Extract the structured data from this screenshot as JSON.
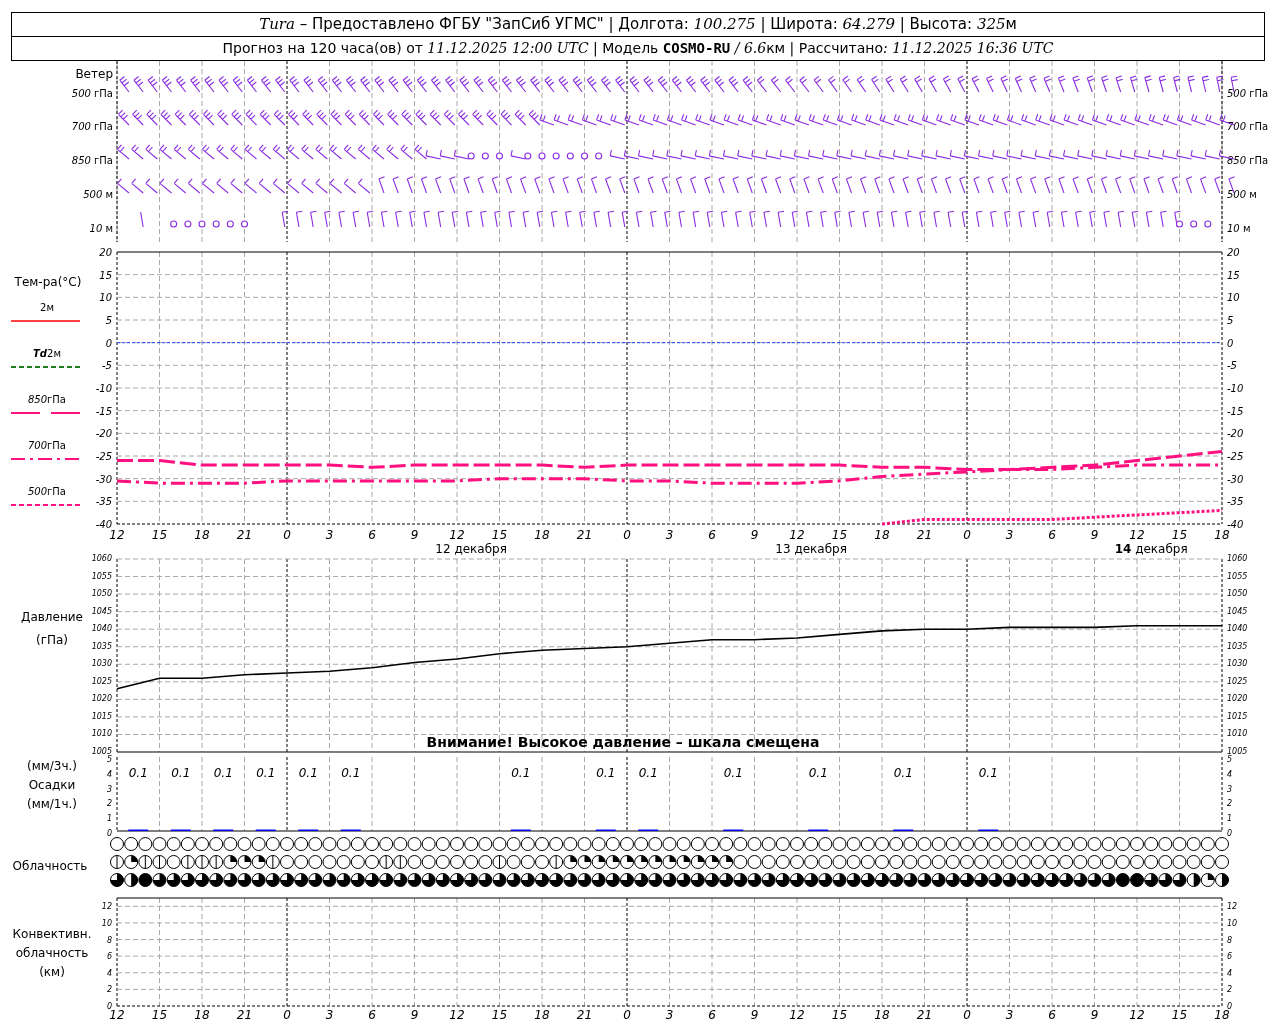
{
  "header": {
    "line1": [
      {
        "text": "Tura",
        "kind": "value"
      },
      {
        "text": " – Предоставлено ФГБУ \"ЗапСиб УГМС\" | Долгота: ",
        "kind": "caption"
      },
      {
        "text": "100.275",
        "kind": "value"
      },
      {
        "text": " | Широта: ",
        "kind": "caption"
      },
      {
        "text": "64.279",
        "kind": "value"
      },
      {
        "text": " | Высота: ",
        "kind": "caption"
      },
      {
        "text": "325",
        "kind": "value"
      },
      {
        "text": "м",
        "kind": "caption"
      }
    ],
    "line2": [
      {
        "text": "Прогноз на 120 часа(ов) от ",
        "kind": "caption"
      },
      {
        "text": "11.12.2025 12:00 UTC",
        "kind": "value"
      },
      {
        "text": "  | Модель ",
        "kind": "caption"
      },
      {
        "text": "COSMO-RU",
        "kind": "model"
      },
      {
        "text": " / 6.6",
        "kind": "value"
      },
      {
        "text": "км | Рассчитано",
        "kind": "caption"
      },
      {
        "text": ": 11.12.2025 16:36 UTC",
        "kind": "value"
      }
    ]
  },
  "wind": {
    "title": "Ветер",
    "levels": [
      {
        "value": "500",
        "unit": "гПа"
      },
      {
        "value": "700",
        "unit": "гПа"
      },
      {
        "value": "850",
        "unit": "гПа"
      },
      {
        "value": "500",
        "unit": "м"
      },
      {
        "value": "10",
        "unit": "м"
      }
    ],
    "right_levels": [
      {
        "value": "500",
        "unit": "гПа"
      },
      {
        "value": "700",
        "unit": "гПа"
      },
      {
        "value": "850",
        "unit": "гПа"
      },
      {
        "value": "500",
        "unit": "м"
      },
      {
        "value": "10",
        "unit": "м"
      }
    ]
  },
  "temperature": {
    "title": "Тем-ра(°C)",
    "legend": [
      {
        "unit": "2м",
        "kind": "solid",
        "color": "#ff4040"
      },
      {
        "value": "Td",
        "unit": "2м",
        "kind": "dashed",
        "color": "#208020"
      },
      {
        "value": "850",
        "unit": "гПа",
        "kind": "broken",
        "color": "#ff1080"
      },
      {
        "value": "700",
        "unit": "гПа",
        "kind": "dashdot",
        "color": "#ff1080"
      },
      {
        "value": "500",
        "unit": "гПа",
        "kind": "dashed",
        "color": "#ff1080"
      }
    ],
    "right_ticks": [
      "20",
      "15",
      "10",
      "5",
      "0",
      "-5",
      "-10",
      "-15",
      "-20",
      "-25",
      "-30",
      "-35",
      "-40"
    ],
    "chart_data": {
      "type": "line",
      "grid": true,
      "ylim": [
        -40,
        20
      ],
      "yticks": [
        20,
        15,
        10,
        5,
        0,
        -5,
        -10,
        -15,
        -20,
        -25,
        -30,
        -35,
        -40
      ],
      "categories": [
        "12",
        "15",
        "18",
        "21",
        "0",
        "3",
        "6",
        "9",
        "12",
        "15",
        "18",
        "21",
        "0",
        "3",
        "6",
        "9",
        "12",
        "15",
        "18",
        "21",
        "0",
        "3",
        "6",
        "9",
        "12",
        "15",
        "18"
      ],
      "ref_lines": [
        {
          "axis": "y",
          "value": 0,
          "color": "#2040ff",
          "line_style": "dotted"
        }
      ],
      "series": [
        {
          "color": "#ff1080",
          "line_style": "dashed",
          "values": [
            -26,
            -26,
            -27,
            -27,
            -27,
            -27,
            -27.5,
            -27,
            -27,
            -27,
            -27,
            -27.5,
            -27,
            -27,
            -27,
            -27,
            -27,
            -27,
            -27.5,
            -27.5,
            -28,
            -28,
            -27.5,
            -27,
            -26,
            -25,
            -24
          ]
        },
        {
          "color": "#ff1080",
          "line_style": "dashdot",
          "values": [
            -30.5,
            -31,
            -31,
            -31,
            -30.5,
            -30.5,
            -30.5,
            -30.5,
            -30.5,
            -30,
            -30,
            -30,
            -30.5,
            -30.5,
            -31,
            -31,
            -31,
            -30.5,
            -29.5,
            -29,
            -28.5,
            -28,
            -28,
            -27.5,
            -27,
            -27,
            -27
          ]
        },
        {
          "color": "#ff1080",
          "line_style": "dotted",
          "values": [
            null,
            null,
            null,
            null,
            null,
            null,
            null,
            null,
            null,
            null,
            null,
            null,
            null,
            null,
            null,
            null,
            null,
            null,
            -40,
            -39,
            -39,
            -39,
            -39,
            -38.5,
            -38,
            -37.5,
            -37
          ]
        }
      ]
    }
  },
  "date_labels": [
    {
      "day": "12",
      "month": "декабря",
      "highlighted": false
    },
    {
      "day": "13",
      "month": "декабря",
      "highlighted": false
    },
    {
      "day": "14",
      "month": "декабря",
      "highlighted": true
    }
  ],
  "pressure": {
    "title": "Давление",
    "unit": "(гПа)",
    "right_ticks": [
      "1060",
      "1055",
      "1050",
      "1045",
      "1040",
      "1035",
      "1030",
      "1025",
      "1020",
      "1015",
      "1010",
      "1005"
    ],
    "chart_data": {
      "type": "line",
      "grid": true,
      "ylim": [
        1005,
        1060
      ],
      "yticks": [
        1060,
        1055,
        1050,
        1045,
        1040,
        1035,
        1030,
        1025,
        1020,
        1015,
        1010,
        1005
      ],
      "series": [
        {
          "color": "#000000",
          "values": [
            1023,
            1026,
            1026,
            1027,
            1027.5,
            1028,
            1029,
            1030.5,
            1031.5,
            1033,
            1034,
            1034.5,
            1035,
            1036,
            1037,
            1037,
            1037.5,
            1038.5,
            1039.5,
            1040,
            1040,
            1040.5,
            1040.5,
            1040.5,
            1041,
            1041,
            1041
          ]
        }
      ],
      "annotations": [
        "Внимание! Высокое давление – шкала смещена"
      ]
    }
  },
  "precipitation": {
    "labels": [
      "(мм/3ч.)",
      "Осадки",
      "(мм/1ч.)"
    ],
    "right_ticks": [
      "5",
      "4",
      "3",
      "2",
      "1",
      "0"
    ],
    "chart_data": {
      "type": "bar",
      "grid": true,
      "ylim": [
        0,
        5
      ],
      "yticks": [
        5,
        4,
        3,
        2,
        1,
        0
      ],
      "value_labels": [
        "0.1",
        "0.1",
        "0.1",
        "0.1",
        "0.1",
        "0.1",
        null,
        null,
        null,
        "0.1",
        null,
        "0.1",
        "0.1",
        null,
        "0.1",
        null,
        "0.1",
        null,
        "0.1",
        null,
        "0.1",
        null,
        null,
        null,
        null,
        null
      ],
      "series": [
        {
          "color": "#0000ff",
          "values": [
            0.1,
            0.1,
            0.1,
            0.1,
            0.1,
            0.1,
            0,
            0,
            0,
            0.1,
            0,
            0.1,
            0.1,
            0,
            0.1,
            0,
            0.1,
            0,
            0.1,
            0,
            0.1,
            0,
            0,
            0,
            0,
            0
          ]
        }
      ]
    }
  },
  "cloudiness": {
    "title": "Облачность",
    "rows": [
      {
        "cells": [
          {
            "kind": "clear"
          },
          {
            "kind": "clear"
          },
          {
            "kind": "clear"
          },
          {
            "kind": "clear"
          },
          {
            "kind": "clear"
          },
          {
            "kind": "clear"
          },
          {
            "kind": "clear"
          },
          {
            "kind": "clear"
          },
          {
            "kind": "clear"
          },
          {
            "kind": "clear"
          },
          {
            "kind": "clear"
          },
          {
            "kind": "clear"
          },
          {
            "kind": "clear"
          },
          {
            "kind": "clear"
          },
          {
            "kind": "clear"
          },
          {
            "kind": "clear"
          },
          {
            "kind": "clear"
          },
          {
            "kind": "clear"
          },
          {
            "kind": "clear"
          },
          {
            "kind": "clear"
          },
          {
            "kind": "clear"
          },
          {
            "kind": "clear"
          },
          {
            "kind": "clear"
          },
          {
            "kind": "clear"
          },
          {
            "kind": "clear"
          },
          {
            "kind": "clear"
          },
          {
            "kind": "clear"
          },
          {
            "kind": "clear"
          },
          {
            "kind": "clear"
          },
          {
            "kind": "clear"
          },
          {
            "kind": "clear"
          },
          {
            "kind": "clear"
          },
          {
            "kind": "clear"
          },
          {
            "kind": "clear"
          },
          {
            "kind": "clear"
          },
          {
            "kind": "clear"
          },
          {
            "kind": "clear"
          },
          {
            "kind": "clear"
          },
          {
            "kind": "clear"
          },
          {
            "kind": "clear"
          },
          {
            "kind": "clear"
          },
          {
            "kind": "clear"
          },
          {
            "kind": "clear"
          },
          {
            "kind": "clear"
          },
          {
            "kind": "clear"
          },
          {
            "kind": "clear"
          },
          {
            "kind": "clear"
          },
          {
            "kind": "clear"
          },
          {
            "kind": "clear"
          },
          {
            "kind": "clear"
          },
          {
            "kind": "clear"
          },
          {
            "kind": "clear"
          },
          {
            "kind": "clear"
          },
          {
            "kind": "clear"
          },
          {
            "kind": "clear"
          },
          {
            "kind": "clear"
          },
          {
            "kind": "clear"
          },
          {
            "kind": "clear"
          },
          {
            "kind": "clear"
          },
          {
            "kind": "clear"
          },
          {
            "kind": "clear"
          },
          {
            "kind": "clear"
          },
          {
            "kind": "clear"
          },
          {
            "kind": "clear"
          },
          {
            "kind": "clear"
          },
          {
            "kind": "clear"
          },
          {
            "kind": "clear"
          },
          {
            "kind": "clear"
          },
          {
            "kind": "clear"
          },
          {
            "kind": "clear"
          },
          {
            "kind": "clear"
          },
          {
            "kind": "clear"
          },
          {
            "kind": "clear"
          },
          {
            "kind": "clear"
          },
          {
            "kind": "clear"
          },
          {
            "kind": "clear"
          },
          {
            "kind": "clear"
          },
          {
            "kind": "clear"
          },
          {
            "kind": "clear"
          }
        ]
      },
      {
        "cells": [
          {
            "kind": "line"
          },
          {
            "kind": "quarter"
          },
          {
            "kind": "line"
          },
          {
            "kind": "line"
          },
          {
            "kind": "clear"
          },
          {
            "kind": "line"
          },
          {
            "kind": "line"
          },
          {
            "kind": "line"
          },
          {
            "kind": "quarter"
          },
          {
            "kind": "quarter"
          },
          {
            "kind": "quarter"
          },
          {
            "kind": "line"
          },
          {
            "kind": "clear"
          },
          {
            "kind": "clear"
          },
          {
            "kind": "clear"
          },
          {
            "kind": "clear"
          },
          {
            "kind": "clear"
          },
          {
            "kind": "clear"
          },
          {
            "kind": "clear"
          },
          {
            "kind": "line"
          },
          {
            "kind": "line"
          },
          {
            "kind": "clear"
          },
          {
            "kind": "clear"
          },
          {
            "kind": "clear"
          },
          {
            "kind": "clear"
          },
          {
            "kind": "clear"
          },
          {
            "kind": "clear"
          },
          {
            "kind": "line"
          },
          {
            "kind": "clear"
          },
          {
            "kind": "clear"
          },
          {
            "kind": "clear"
          },
          {
            "kind": "line"
          },
          {
            "kind": "quarter"
          },
          {
            "kind": "quarter"
          },
          {
            "kind": "quarter"
          },
          {
            "kind": "quarter"
          },
          {
            "kind": "quarter"
          },
          {
            "kind": "quarter"
          },
          {
            "kind": "quarter"
          },
          {
            "kind": "quarter"
          },
          {
            "kind": "quarter"
          },
          {
            "kind": "quarter"
          },
          {
            "kind": "quarter"
          },
          {
            "kind": "quarter"
          },
          {
            "kind": "clear"
          },
          {
            "kind": "clear"
          },
          {
            "kind": "clear"
          },
          {
            "kind": "clear"
          },
          {
            "kind": "clear"
          },
          {
            "kind": "clear"
          },
          {
            "kind": "clear"
          },
          {
            "kind": "clear"
          },
          {
            "kind": "clear"
          },
          {
            "kind": "clear"
          },
          {
            "kind": "clear"
          },
          {
            "kind": "clear"
          },
          {
            "kind": "clear"
          },
          {
            "kind": "clear"
          },
          {
            "kind": "clear"
          },
          {
            "kind": "clear"
          },
          {
            "kind": "clear"
          },
          {
            "kind": "clear"
          },
          {
            "kind": "clear"
          },
          {
            "kind": "clear"
          },
          {
            "kind": "clear"
          },
          {
            "kind": "clear"
          },
          {
            "kind": "clear"
          },
          {
            "kind": "clear"
          },
          {
            "kind": "clear"
          },
          {
            "kind": "clear"
          },
          {
            "kind": "clear"
          },
          {
            "kind": "clear"
          },
          {
            "kind": "clear"
          },
          {
            "kind": "clear"
          },
          {
            "kind": "clear"
          },
          {
            "kind": "clear"
          },
          {
            "kind": "clear"
          },
          {
            "kind": "clear"
          },
          {
            "kind": "clear"
          }
        ]
      },
      {
        "cells": [
          {
            "kind": "most"
          },
          {
            "kind": "half"
          },
          {
            "kind": "overcast"
          },
          {
            "kind": "most"
          },
          {
            "kind": "most"
          },
          {
            "kind": "most"
          },
          {
            "kind": "most"
          },
          {
            "kind": "most"
          },
          {
            "kind": "most"
          },
          {
            "kind": "most"
          },
          {
            "kind": "most"
          },
          {
            "kind": "most"
          },
          {
            "kind": "most"
          },
          {
            "kind": "most"
          },
          {
            "kind": "most"
          },
          {
            "kind": "most"
          },
          {
            "kind": "most"
          },
          {
            "kind": "most"
          },
          {
            "kind": "most"
          },
          {
            "kind": "most"
          },
          {
            "kind": "most"
          },
          {
            "kind": "most"
          },
          {
            "kind": "most"
          },
          {
            "kind": "most"
          },
          {
            "kind": "most"
          },
          {
            "kind": "most"
          },
          {
            "kind": "most"
          },
          {
            "kind": "most"
          },
          {
            "kind": "most"
          },
          {
            "kind": "most"
          },
          {
            "kind": "most"
          },
          {
            "kind": "most"
          },
          {
            "kind": "most"
          },
          {
            "kind": "most"
          },
          {
            "kind": "most"
          },
          {
            "kind": "most"
          },
          {
            "kind": "most"
          },
          {
            "kind": "most"
          },
          {
            "kind": "most"
          },
          {
            "kind": "most"
          },
          {
            "kind": "most"
          },
          {
            "kind": "most"
          },
          {
            "kind": "most"
          },
          {
            "kind": "most"
          },
          {
            "kind": "most"
          },
          {
            "kind": "most"
          },
          {
            "kind": "most"
          },
          {
            "kind": "most"
          },
          {
            "kind": "most"
          },
          {
            "kind": "most"
          },
          {
            "kind": "most"
          },
          {
            "kind": "most"
          },
          {
            "kind": "most"
          },
          {
            "kind": "most"
          },
          {
            "kind": "most"
          },
          {
            "kind": "most"
          },
          {
            "kind": "most"
          },
          {
            "kind": "most"
          },
          {
            "kind": "most"
          },
          {
            "kind": "most"
          },
          {
            "kind": "most"
          },
          {
            "kind": "most"
          },
          {
            "kind": "most"
          },
          {
            "kind": "most"
          },
          {
            "kind": "most"
          },
          {
            "kind": "most"
          },
          {
            "kind": "most"
          },
          {
            "kind": "most"
          },
          {
            "kind": "most"
          },
          {
            "kind": "most"
          },
          {
            "kind": "most"
          },
          {
            "kind": "overcast"
          },
          {
            "kind": "overcast"
          },
          {
            "kind": "most"
          },
          {
            "kind": "most"
          },
          {
            "kind": "most"
          },
          {
            "kind": "half"
          },
          {
            "kind": "quarter"
          },
          {
            "kind": "half"
          }
        ]
      }
    ]
  },
  "convective": {
    "labels": [
      "Конвективн.",
      "облачность",
      "(км)"
    ],
    "right_ticks": [
      "12",
      "10",
      "8",
      "6",
      "4",
      "2",
      "0"
    ],
    "chart_data": {
      "type": "line",
      "grid": true,
      "ylim": [
        0,
        13
      ],
      "yticks": [
        12,
        10,
        8,
        6,
        4,
        2,
        0
      ],
      "categories": [
        "12",
        "15",
        "18",
        "21",
        "0",
        "3",
        "6",
        "9",
        "12",
        "15",
        "18",
        "21",
        "0",
        "3",
        "6",
        "9",
        "12",
        "15",
        "18",
        "21",
        "0",
        "3",
        "6",
        "9",
        "12",
        "15",
        "18"
      ]
    }
  }
}
